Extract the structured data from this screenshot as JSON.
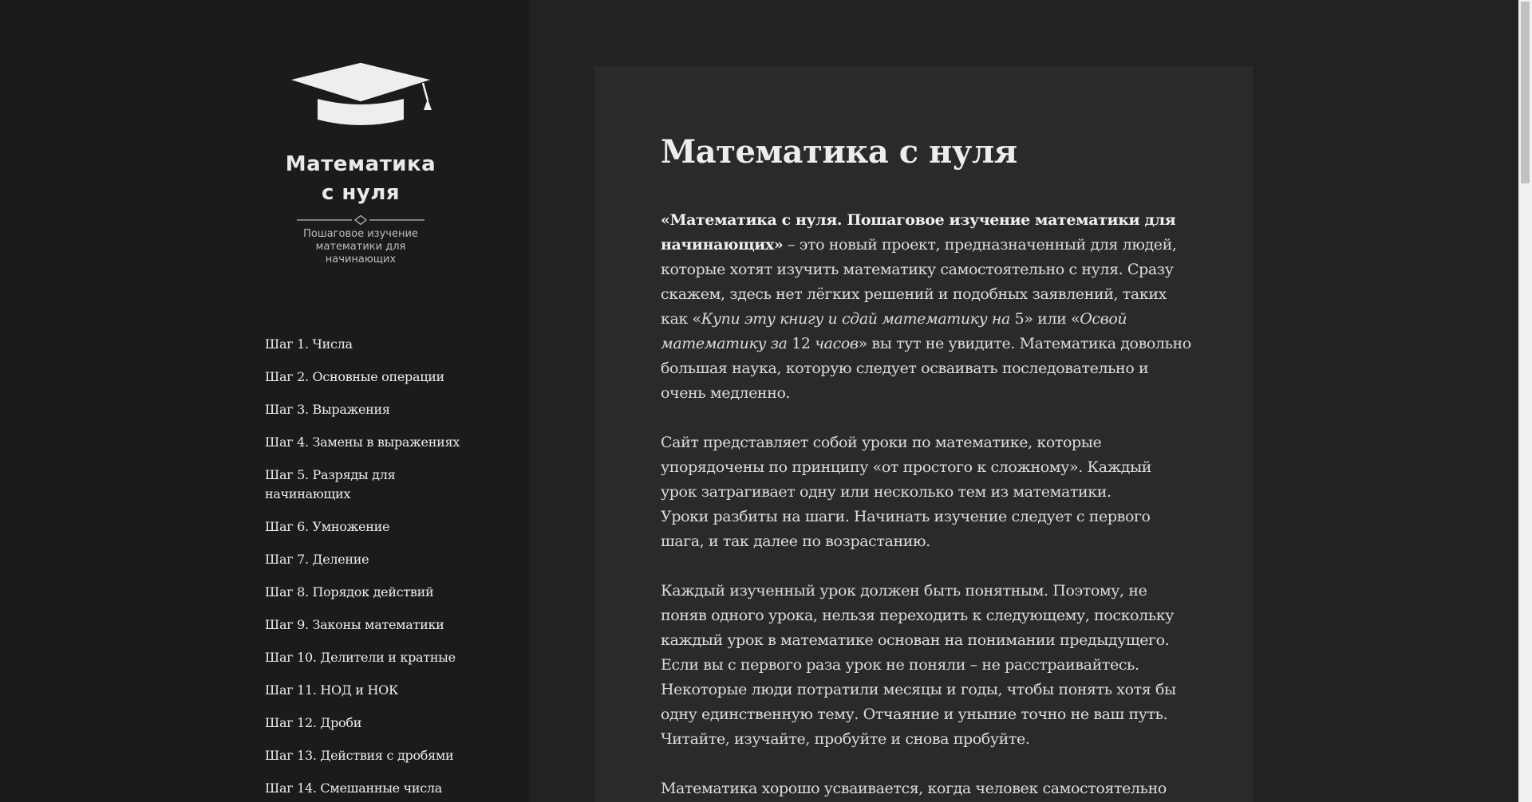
{
  "site": {
    "title_line1": "Математика",
    "title_line2": "с нуля",
    "tagline": "Пошаговое изучение математики для начинающих"
  },
  "nav": {
    "items": [
      "Шаг 1. Числа",
      "Шаг 2. Основные операции",
      "Шаг 3. Выражения",
      "Шаг 4. Замены в выражениях",
      "Шаг 5. Разряды для начинающих",
      "Шаг 6. Умножение",
      "Шаг 7. Деление",
      "Шаг 8. Порядок действий",
      "Шаг 9. Законы математики",
      "Шаг 10. Делители и кратные",
      "Шаг 11. НОД и НОК",
      "Шаг 12. Дроби",
      "Шаг 13. Действия с дробями",
      "Шаг 14. Смешанные числа"
    ]
  },
  "article": {
    "title": "Математика с нуля",
    "p1_bold": "«Математика с нуля. Пошаговое изучение математики для начинающих»",
    "p1_text_a": " – это новый проект, предназначенный для людей, которые хотят изучить математику самостоятельно с нуля. Сразу скажем, здесь нет лёгких решений и подобных заявлений, таких как «",
    "p1_italic_1": "Купи эту книгу и сдай математику на ",
    "p1_num_1": "5",
    "p1_text_b": "» или «",
    "p1_italic_2": "Освой математику за ",
    "p1_num_2": "12",
    "p1_italic_3": " часов",
    "p1_text_c": "» вы тут не увидите. Математика довольно большая наука, которую следует осваивать последовательно и очень медленно.",
    "p2_line1": "Сайт представляет собой уроки по математике, которые упорядочены по принципу «от простого к сложному». Каждый урок затрагивает одну или несколько тем из математики.",
    "p2_line2": "Уроки разбиты на шаги. Начинать изучение следует с первого шага, и так далее по возрастанию.",
    "p3": "Каждый изученный урок должен быть понятным. Поэтому, не поняв одного урока, нельзя переходить к следующему, поскольку каждый урок в математике основан на понимании предыдущего. Если вы с первого раза урок не поняли – не расстраивайтесь. Некоторые люди потратили месяцы и годы, чтобы понять хотя бы одну единственную тему. Отчаяние и уныние точно не ваш путь. Читайте, изучайте, пробуйте и снова пробуйте.",
    "p4": "Математика хорошо усваивается, когда человек самостоятельно"
  },
  "icons": {
    "logo": "graduation-cap-icon",
    "divider": "diamond-divider"
  },
  "colors": {
    "sidebar_bg": "#1b1b1b",
    "page_bg": "#222222",
    "card_bg": "#2a2a2a",
    "text": "#dcdcdc"
  }
}
